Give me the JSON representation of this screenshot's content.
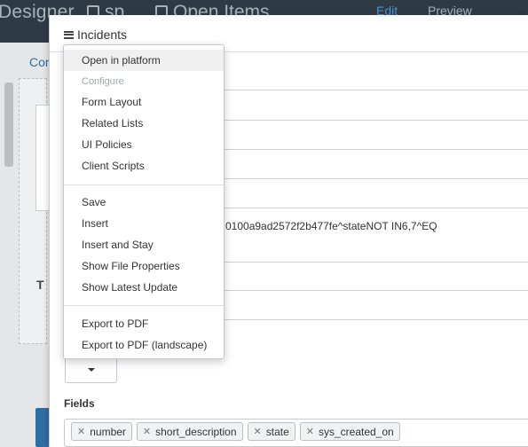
{
  "background": {
    "app_title": "Designer",
    "tab_sp": "sp",
    "tab_open_items": "Open Items",
    "edit_label": "Edit",
    "preview_label": "Preview",
    "left_label": "Cor",
    "panel_letter": "T"
  },
  "modal": {
    "title": "Incidents",
    "query_text": "0100a9ad2572f2b477fe^stateNOT IN6,7^EQ",
    "fields_label": "Fields",
    "fields": [
      "number",
      "short_description",
      "state",
      "sys_created_on"
    ]
  },
  "menu": {
    "items": [
      {
        "label": "Open in platform",
        "state": "hover"
      },
      {
        "label": "Configure",
        "state": "disabled"
      },
      {
        "label": "Form Layout"
      },
      {
        "label": "Related Lists"
      },
      {
        "label": "UI Policies"
      },
      {
        "label": "Client Scripts"
      },
      {
        "label": "Save"
      },
      {
        "label": "Insert"
      },
      {
        "label": "Insert and Stay"
      },
      {
        "label": "Show File Properties"
      },
      {
        "label": "Show Latest Update"
      },
      {
        "label": "Export to PDF"
      },
      {
        "label": "Export to PDF (landscape)"
      }
    ]
  },
  "colors": {
    "topbar": "#2e3b45",
    "accent": "#4a93d8",
    "hover": "#f0f0f0"
  }
}
